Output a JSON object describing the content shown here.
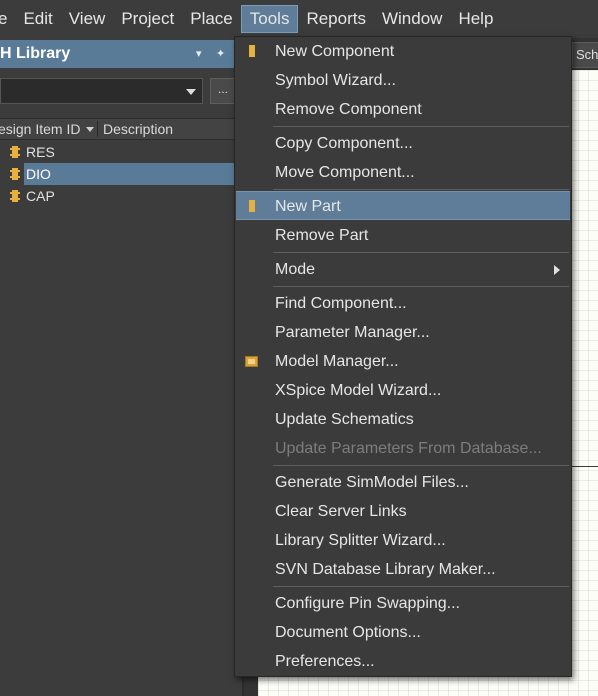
{
  "menubar": {
    "items": [
      "e",
      "Edit",
      "View",
      "Project",
      "Place",
      "Tools",
      "Reports",
      "Window",
      "Help"
    ],
    "active_index": 5
  },
  "panel": {
    "title": "H Library",
    "pin_glyph": "▾",
    "dock_glyph": "✦",
    "filter_value": "",
    "browse_label": "...",
    "columns": [
      "esign Item ID",
      "Description"
    ],
    "rows": [
      {
        "name": "RES",
        "selected": false
      },
      {
        "name": "DIO",
        "selected": true
      },
      {
        "name": "CAP",
        "selected": false
      }
    ]
  },
  "document": {
    "tab_label": "Sch"
  },
  "tools_menu": {
    "items": [
      {
        "label": "New Component",
        "icon": "component-icon"
      },
      {
        "label": "Symbol Wizard..."
      },
      {
        "label": "Remove Component"
      },
      {
        "separator": true
      },
      {
        "label": "Copy Component..."
      },
      {
        "label": "Move Component..."
      },
      {
        "separator": true
      },
      {
        "label": "New Part",
        "icon": "part-icon",
        "highlighted": true
      },
      {
        "label": "Remove Part"
      },
      {
        "separator": true
      },
      {
        "label": "Mode",
        "submenu": true
      },
      {
        "separator": true
      },
      {
        "label": "Find Component..."
      },
      {
        "label": "Parameter Manager..."
      },
      {
        "label": "Model Manager...",
        "icon": "model-manager-icon"
      },
      {
        "label": "XSpice Model Wizard..."
      },
      {
        "label": "Update Schematics"
      },
      {
        "label": "Update Parameters From Database...",
        "disabled": true
      },
      {
        "separator": true
      },
      {
        "label": "Generate SimModel Files..."
      },
      {
        "label": "Clear Server Links"
      },
      {
        "label": "Library Splitter Wizard..."
      },
      {
        "label": "SVN Database Library Maker..."
      },
      {
        "separator": true
      },
      {
        "label": "Configure Pin Swapping..."
      },
      {
        "label": "Document Options..."
      },
      {
        "label": "Preferences..."
      }
    ]
  },
  "colors": {
    "highlight": "#5f7d99",
    "panel_title": "#5a7b98",
    "component_icon": "#e7b13f"
  }
}
